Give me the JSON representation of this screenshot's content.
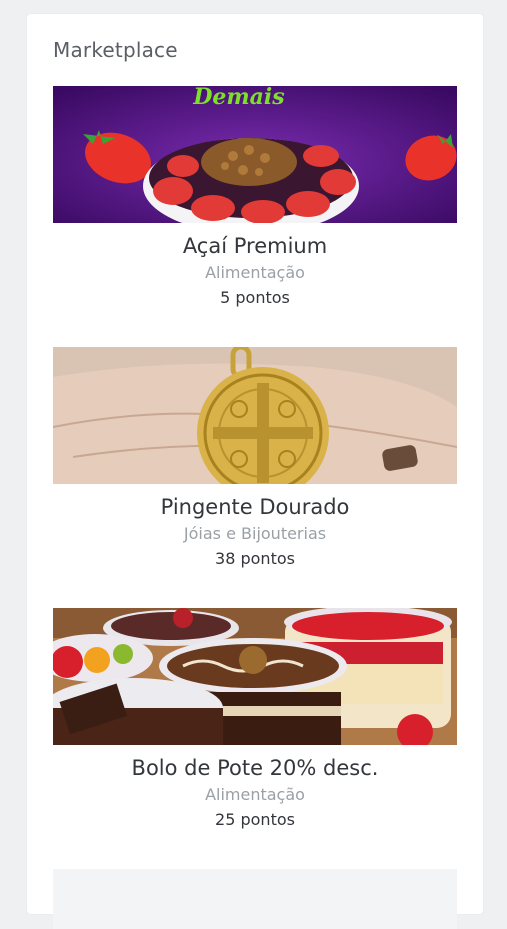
{
  "page": {
    "title": "Marketplace"
  },
  "items": [
    {
      "name": "Açaí Premium",
      "category": "Alimentação",
      "points": "5 pontos",
      "image_text": "Demais",
      "image": "acai-bowl-image"
    },
    {
      "name": "Pingente Dourado",
      "category": "Jóias e Bijouterias",
      "points": "38 pontos",
      "image": "gold-pendant-image"
    },
    {
      "name": "Bolo de Pote 20% desc.",
      "category": "Alimentação",
      "points": "25 pontos",
      "image": "cake-jars-image"
    }
  ],
  "colors": {
    "background": "#eef0f2",
    "panel": "#ffffff",
    "title": "#5a5f66",
    "name": "#33363b",
    "category": "#9aa0a6",
    "acai_purple": "#5a1a8a",
    "acai_text": "#7ee02a"
  }
}
